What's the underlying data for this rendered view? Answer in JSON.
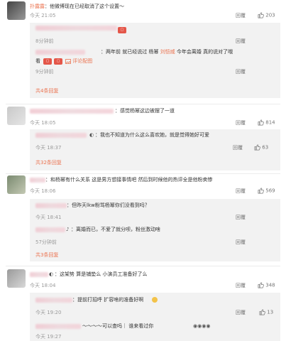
{
  "comments": [
    {
      "user": "扑露露",
      "text": "：他微博现在已经取消了这个设置～",
      "time": "今天 21:05",
      "reply": "回覆",
      "likes": "203",
      "subreplies": [
        {
          "time": "8分钟前",
          "reply": "回覆"
        },
        {
          "text": "：两年前 就已经说过 杨幂 ",
          "name2": "刘恺威",
          "text2": " 今年会离婚 真的说对了哦",
          "text3": "看",
          "comment_link": "评论配图",
          "time": "9分钟前",
          "reply": "回覆"
        }
      ],
      "more": "共4条回复"
    },
    {
      "text": "：感觉杨幂这边被摆了一道",
      "time": "今天 18:05",
      "reply": "回覆",
      "likes": "814",
      "subreplies": [
        {
          "text": "：我也不知道为什么这么喜欢她，就是觉得她好可爱",
          "time": "今天 18:37",
          "reply": "回覆",
          "likes": "63"
        }
      ],
      "more": "共32条回复"
    },
    {
      "text": "：和杨幂有什么关系 这是男方想接事情吧 然后到时候他的热评全是他粉卖惨",
      "time": "今天 18:06",
      "reply": "回覆",
      "likes": "569",
      "subreplies": [
        {
          "text": "：但昨天lkw粉骂杨幂你们没看到吗？",
          "time": "今天 18:41",
          "reply": "回覆"
        },
        {
          "text": "：离婚而已，不爱了就分呗，粉丝激动啥",
          "time": "57分钟前",
          "reply": "回覆"
        }
      ],
      "more": "共3条回复"
    },
    {
      "text": "：这架势 算是铺垫么 小演员工准备好了么",
      "time": "今天 18:04",
      "reply": "回覆",
      "likes": "348",
      "subreplies": [
        {
          "text": "：提前打招呼 扩容啥的准备好啊",
          "time": "今天 19:20",
          "reply": "回覆",
          "likes": "13"
        },
        {
          "text": "～～～～可以查吗｜ 谁来看过你",
          "time": "今天 19:27"
        }
      ]
    }
  ],
  "icons": {
    "like": "thumb-up-icon",
    "image": "image-icon",
    "sticker": "sticker-icon"
  },
  "colors": {
    "link": "#eb7350",
    "background": "#ffffff",
    "subreply_bg": "#f2f2f2"
  }
}
